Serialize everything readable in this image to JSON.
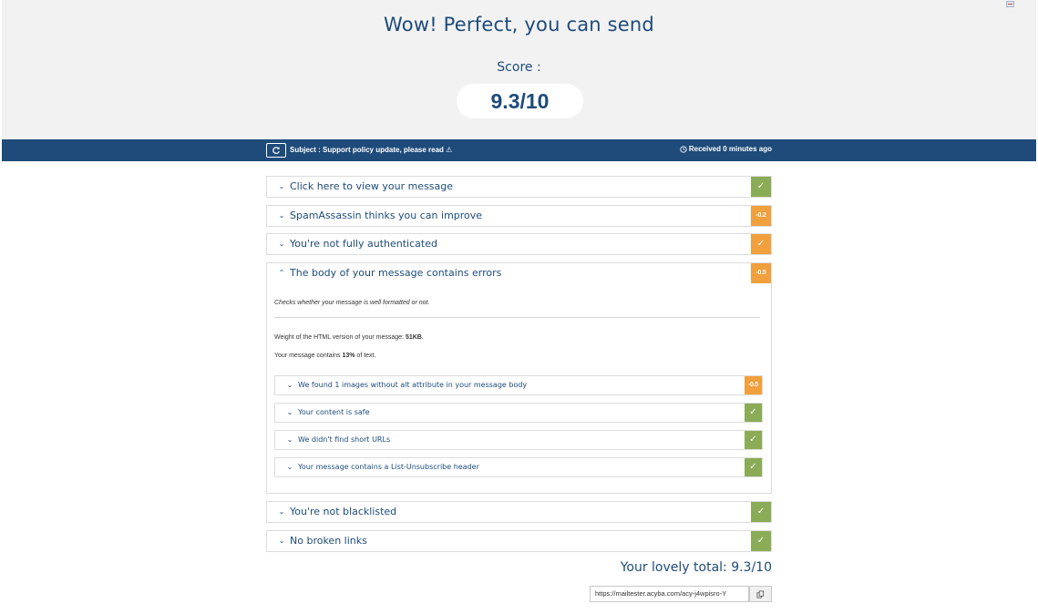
{
  "hero": {
    "title": "Wow! Perfect, you can send",
    "score_label": "Score :",
    "score_value": "9.3/10"
  },
  "infobar": {
    "subject": "Subject : Support policy update, please read ⚠",
    "received": "Received 0 minutes ago"
  },
  "sections": [
    {
      "title": "Click here to view your message",
      "status": "✓",
      "status_kind": "ok"
    },
    {
      "title": "SpamAssassin thinks you can improve",
      "status": "-0.2",
      "status_kind": "warn"
    },
    {
      "title": "You're not fully authenticated",
      "status": "✓",
      "status_kind": "warn"
    },
    {
      "title": "The body of your message contains errors",
      "status": "-0.5",
      "status_kind": "warn"
    },
    {
      "title": "You're not blacklisted",
      "status": "✓",
      "status_kind": "ok"
    },
    {
      "title": "No broken links",
      "status": "✓",
      "status_kind": "ok"
    }
  ],
  "body_section": {
    "description": "Checks whether your message is well formatted or not.",
    "weight_prefix": "Weight of the HTML version of your message: ",
    "weight_value": "51KB",
    "weight_suffix": ".",
    "text_prefix": "Your message contains ",
    "text_value": "13%",
    "text_suffix": " of text.",
    "subsections": [
      {
        "title": "We found 1 images without alt attribute in your message body",
        "status": "-0.5",
        "status_kind": "warn"
      },
      {
        "title": "Your content is safe",
        "status": "✓",
        "status_kind": "ok"
      },
      {
        "title": "We didn't find short URLs",
        "status": "✓",
        "status_kind": "ok"
      },
      {
        "title": "Your message contains a List-Unsubscribe header",
        "status": "✓",
        "status_kind": "ok"
      }
    ]
  },
  "footer": {
    "total": "Your lovely total: 9.3/10",
    "url": "https://mailtester.acyba.com/acy-j4wpisro-Y"
  },
  "icons": {
    "chevron_down": "⌄",
    "chevron_up": "⌃",
    "clock": "clock-icon",
    "refresh": "refresh-icon",
    "copy": "copy-icon",
    "flag": "flag-icon"
  },
  "colors": {
    "primary": "#1e4b7a",
    "ok": "#8aac57",
    "warn": "#f0a03c",
    "hero_bg": "#f2f2f2"
  }
}
